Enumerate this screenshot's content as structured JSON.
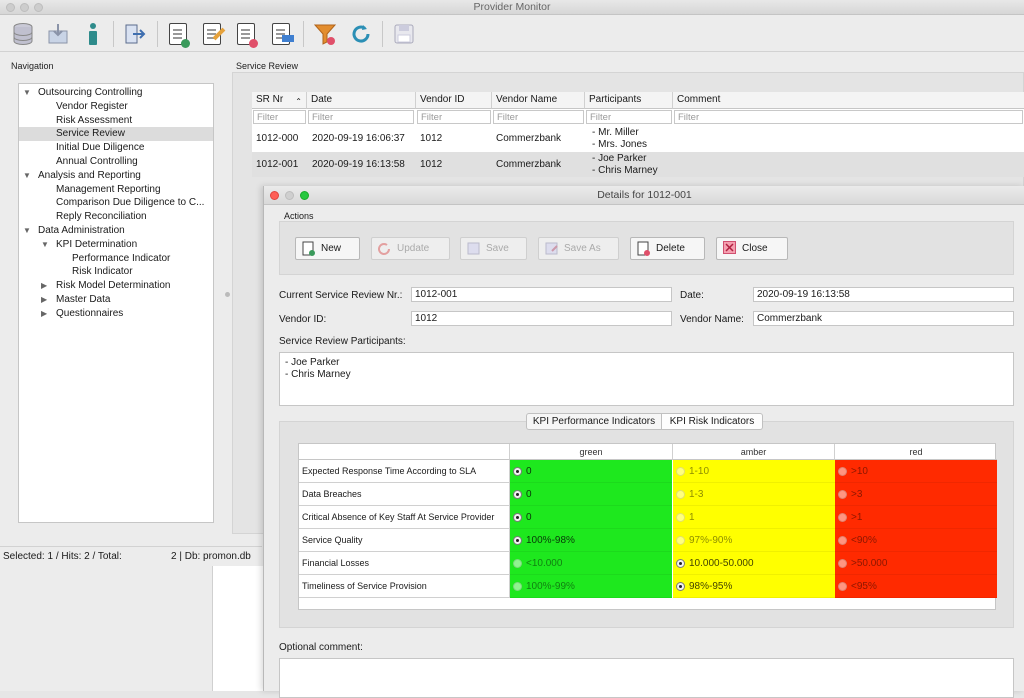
{
  "app": {
    "title": "Provider Monitor"
  },
  "toolbar": {
    "icons": [
      "database-icon",
      "import-icon",
      "info-icon",
      "exit-icon",
      "new-document-icon",
      "edit-document-icon",
      "delete-document-icon",
      "sla-document-icon",
      "filter-icon",
      "refresh-icon",
      "save-icon"
    ]
  },
  "navigation": {
    "label": "Navigation",
    "items": [
      {
        "label": "Outsourcing Controlling",
        "level": 0,
        "arrow": "▼"
      },
      {
        "label": "Vendor Register",
        "level": 1,
        "arrow": ""
      },
      {
        "label": "Risk Assessment",
        "level": 1,
        "arrow": ""
      },
      {
        "label": "Service Review",
        "level": 1,
        "arrow": "",
        "selected": true
      },
      {
        "label": "Initial Due Diligence",
        "level": 1,
        "arrow": ""
      },
      {
        "label": "Annual Controlling",
        "level": 1,
        "arrow": ""
      },
      {
        "label": "Analysis and Reporting",
        "level": 0,
        "arrow": "▼"
      },
      {
        "label": "Management Reporting",
        "level": 1,
        "arrow": ""
      },
      {
        "label": "Comparison Due Diligence to C...",
        "level": 1,
        "arrow": ""
      },
      {
        "label": "Reply Reconciliation",
        "level": 1,
        "arrow": ""
      },
      {
        "label": "Data Administration",
        "level": 0,
        "arrow": "▼"
      },
      {
        "label": "KPI Determination",
        "level": 1,
        "arrow": "▼"
      },
      {
        "label": "Performance Indicator",
        "level": 2,
        "arrow": ""
      },
      {
        "label": "Risk Indicator",
        "level": 2,
        "arrow": ""
      },
      {
        "label": "Risk Model Determination",
        "level": 1,
        "arrow": "▶"
      },
      {
        "label": "Master Data",
        "level": 1,
        "arrow": "▶"
      },
      {
        "label": "Questionnaires",
        "level": 1,
        "arrow": "▶"
      }
    ]
  },
  "status": {
    "left": "Selected: 1 / Hits: 2 / Total:",
    "right": "2 | Db: promon.db"
  },
  "service_review": {
    "label": "Service Review",
    "columns": [
      "SR Nr",
      "Date",
      "Vendor ID",
      "Vendor Name",
      "Participants",
      "Comment"
    ],
    "sort_indicator": "⌃",
    "filter_placeholder": "Filter",
    "rows": [
      {
        "sr": "1012-000",
        "date": "2020-09-19 16:06:37",
        "vendor_id": "1012",
        "vendor_name": "Commerzbank",
        "p1": "- Mr. Miller",
        "p2": "- Mrs. Jones",
        "comment": ""
      },
      {
        "sr": "1012-001",
        "date": "2020-09-19 16:13:58",
        "vendor_id": "1012",
        "vendor_name": "Commerzbank",
        "p1": "- Joe Parker",
        "p2": "- Chris Marney",
        "comment": ""
      }
    ]
  },
  "dialog": {
    "title": "Details for 1012-001",
    "actions_label": "Actions",
    "buttons": {
      "new": "New",
      "update": "Update",
      "save": "Save",
      "save_as": "Save As",
      "delete": "Delete",
      "close": "Close"
    },
    "current_sr_label": "Current Service Review Nr.:",
    "current_sr": "1012-001",
    "date_label": "Date:",
    "date": "2020-09-19 16:13:58",
    "vendor_id_label": "Vendor ID:",
    "vendor_id": "1012",
    "vendor_name_label": "Vendor Name:",
    "vendor_name": "Commerzbank",
    "participants_label": "Service Review Participants:",
    "participants": [
      "- Joe Parker",
      "- Chris Marney"
    ],
    "tabs": [
      "KPI Performance Indicators",
      "KPI Risk Indicators"
    ],
    "active_tab": "KPI Performance Indicators",
    "optional_comment_label": "Optional comment:",
    "kpi": {
      "headers": [
        "green",
        "amber",
        "red"
      ],
      "colors": {
        "green": "#1ee81e",
        "amber": "#ffff00",
        "red": "#ff2a00"
      },
      "rows": [
        {
          "name": "Expected Response Time According to SLA",
          "green": "0",
          "amber": "1-10",
          "red": ">10",
          "selected": "green"
        },
        {
          "name": "Data Breaches",
          "green": "0",
          "amber": "1-3",
          "red": ">3",
          "selected": "green"
        },
        {
          "name": "Critical Absence of Key Staff At Service Provider",
          "green": "0",
          "amber": "1",
          "red": ">1",
          "selected": "green"
        },
        {
          "name": "Service Quality",
          "green": "100%-98%",
          "amber": "97%-90%",
          "red": "<90%",
          "selected": "green"
        },
        {
          "name": "Financial Losses",
          "green": "<10.000",
          "amber": "10.000-50.000",
          "red": ">50.000",
          "selected": "amber"
        },
        {
          "name": "Timeliness of Service Provision",
          "green": "100%-99%",
          "amber": "98%-95%",
          "red": "<95%",
          "selected": "amber"
        }
      ]
    }
  }
}
